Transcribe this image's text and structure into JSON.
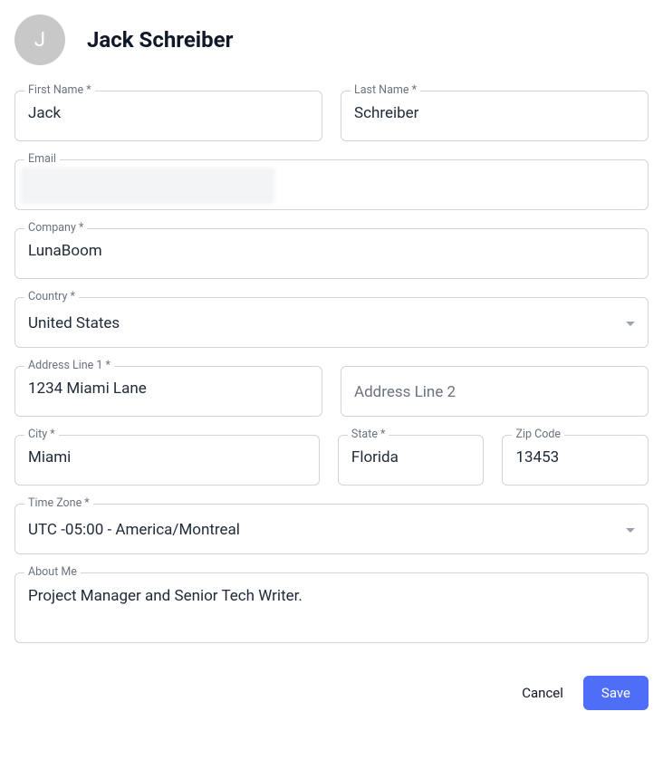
{
  "header": {
    "avatar_initial": "J",
    "full_name": "Jack Schreiber"
  },
  "labels": {
    "first_name": "First Name *",
    "last_name": "Last Name *",
    "email": "Email",
    "company": "Company *",
    "country": "Country *",
    "address1": "Address Line 1 *",
    "address2_placeholder": "Address Line 2",
    "city": "City *",
    "state": "State *",
    "zip": "Zip Code",
    "timezone": "Time Zone *",
    "about": "About Me"
  },
  "values": {
    "first_name": "Jack",
    "last_name": "Schreiber",
    "email": "",
    "company": "LunaBoom",
    "country": "United States",
    "address1": "1234 Miami Lane",
    "address2": "",
    "city": "Miami",
    "state": "Florida",
    "zip": "13453",
    "timezone": "UTC -05:00 - America/Montreal",
    "about": "Project Manager and Senior Tech Writer."
  },
  "actions": {
    "cancel": "Cancel",
    "save": "Save"
  }
}
